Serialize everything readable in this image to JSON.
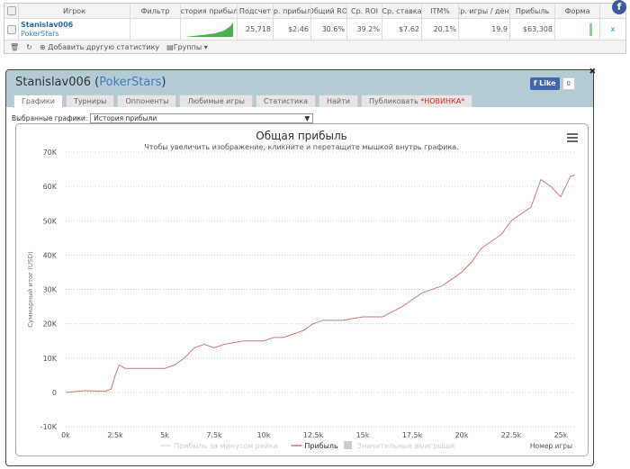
{
  "table": {
    "headers": [
      "Игрок",
      "Фильтр",
      "История прибыли",
      "Подсчет",
      "Ср. прибыль",
      "Общий ROI",
      "Ср. ROI",
      "Ср. ставка",
      "ITM%",
      "Ср. игры / день",
      "Прибыль",
      "Форма"
    ],
    "row": {
      "player": "Stanislav006",
      "network": "PokerStars",
      "filter": "",
      "count": "25,718",
      "avg_profit": "$2.46",
      "total_roi": "30.6%",
      "avg_roi": "39.2%",
      "avg_stake": "$7.62",
      "itm": "20.1%",
      "games_per_day": "19.9",
      "profit": "$63,308"
    },
    "footer": {
      "add_stat": "Добавить другую статистику",
      "groups": "Группы ▾"
    }
  },
  "window": {
    "player": "Stanislav006",
    "network": "PokerStars",
    "tabs": [
      {
        "label": "Графики"
      },
      {
        "label": "Турниры"
      },
      {
        "label": "Оппоненты"
      },
      {
        "label": "Любимые игры"
      },
      {
        "label": "Статистика"
      },
      {
        "label": "Найти"
      },
      {
        "label": "Публиковать",
        "badge": "*НОВИНКА*"
      }
    ],
    "like_label": "Like",
    "like_count": "0",
    "selected_label": "Выбранные графики:",
    "selected_value": "История прибыли"
  },
  "colors": {
    "profit_line": "#c97b7b",
    "accent": "#3a7fc1",
    "header_bg": "#b5cbd3",
    "sparkline": "#4caf50"
  },
  "chart_data": {
    "type": "line",
    "title": "Общая прибыль",
    "subtitle": "Чтобы увеличить изображение, кликните и перетащите мышкой внутрь графика.",
    "ylabel": "Суммарный итог (USD)",
    "xlabel": "Номер игры",
    "xlim": [
      0,
      25718
    ],
    "ylim": [
      -10000,
      70000
    ],
    "x_ticks": [
      "0k",
      "2.5k",
      "5k",
      "7.5k",
      "10k",
      "12.5k",
      "15k",
      "17.5k",
      "20k",
      "22.5k",
      "25k"
    ],
    "y_ticks": [
      "-10K",
      "0",
      "10K",
      "20K",
      "30K",
      "40K",
      "50K",
      "60K",
      "70K"
    ],
    "grid": true,
    "legend": [
      {
        "name": "Прибыль за минусом рейка",
        "active": false
      },
      {
        "name": "Прибыль",
        "active": true
      },
      {
        "name": "Значительные выигрыши",
        "active": false
      }
    ],
    "legend_placement": "bottom",
    "series": [
      {
        "name": "Прибыль",
        "x": [
          0,
          1000,
          2000,
          2300,
          2500,
          2700,
          3000,
          4000,
          5000,
          5500,
          6000,
          6500,
          7000,
          7500,
          8000,
          9000,
          10000,
          10500,
          11000,
          12000,
          12500,
          13000,
          14000,
          15000,
          16000,
          17000,
          18000,
          19000,
          20000,
          20500,
          21000,
          22000,
          22500,
          23500,
          24000,
          24500,
          25000,
          25500,
          25718
        ],
        "y": [
          0,
          500,
          300,
          1000,
          5000,
          8000,
          7000,
          7000,
          7000,
          8000,
          10000,
          13000,
          14000,
          13000,
          14000,
          15000,
          15000,
          16000,
          16000,
          18000,
          20000,
          21000,
          21000,
          22000,
          22000,
          25000,
          29000,
          31000,
          35000,
          38000,
          42000,
          46000,
          50000,
          54000,
          62000,
          60000,
          57000,
          63000,
          63308
        ]
      }
    ]
  }
}
